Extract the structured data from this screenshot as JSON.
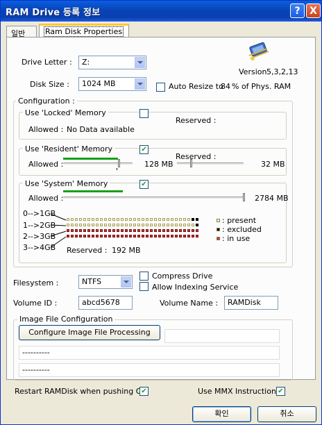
{
  "window": {
    "title": "RAM Drive 등록 정보",
    "help": "?",
    "close": "X"
  },
  "tabs": [
    {
      "label": "일반"
    },
    {
      "label": "Ram Disk Properties"
    }
  ],
  "drive": {
    "letter_label": "Drive Letter :",
    "letter_value": "Z:",
    "size_label": "Disk Size :",
    "size_value": "1024 MB",
    "version_label": "Version",
    "version_value": "5,3,2,13",
    "auto_resize_label": "Auto Resize to",
    "auto_resize_pct": "84",
    "auto_resize_suffix": "% of Phys. RAM"
  },
  "config": {
    "title": "Configuration :",
    "locked": {
      "title": "Use 'Locked' Memory",
      "checked": false,
      "reserved_label": "Reserved :",
      "allowed_label": "Allowed :",
      "allowed_value": "No Data available"
    },
    "resident": {
      "title": "Use 'Resident' Memory",
      "checked": true,
      "reserved_label": "Reserved :",
      "allowed_label": "Allowed :",
      "allowed_value": "128 MB",
      "reserved_value": "32 MB",
      "allowed_fraction": 0.5,
      "reserved_fraction": 0.2
    },
    "system": {
      "title": "Use 'System' Memory",
      "checked": true,
      "allowed_label": "Allowed :",
      "allowed_value": "2784 MB",
      "allowed_fraction": 0.33,
      "rows": [
        {
          "label": "0-->1GB"
        },
        {
          "label": "1-->2GB"
        },
        {
          "label": "2-->3GB"
        },
        {
          "label": "3-->4GB"
        }
      ],
      "reserved_label": "Reserved :",
      "reserved_value": "192 MB",
      "legend": [
        {
          "label": ": present"
        },
        {
          "label": ": excluded"
        },
        {
          "label": ": in use"
        }
      ]
    }
  },
  "filesystem": {
    "label": "Filesystem :",
    "value": "NTFS",
    "compress_label": "Compress Drive",
    "indexing_label": "Allow Indexing Service",
    "volume_id_label": "Volume ID :",
    "volume_id_value": "abcd5678",
    "volume_name_label": "Volume Name :",
    "volume_name_value": "RAMDisk"
  },
  "image": {
    "title": "Image File Configuration",
    "button": "Configure Image File Processing",
    "path1": "----------",
    "path2": "----------"
  },
  "options": {
    "restart_label": "Restart RAMDisk when pushing OK",
    "restart_checked": true,
    "mmx_label": "Use MMX Instructions",
    "mmx_checked": true
  },
  "footer": {
    "ok": "확인",
    "cancel": "취소"
  },
  "colors": {
    "title_bar": "#0a3fb0",
    "bar_green": "#16a016",
    "present": "#fdfdd0",
    "excluded": "#000000",
    "in_use": "#cc3333"
  }
}
